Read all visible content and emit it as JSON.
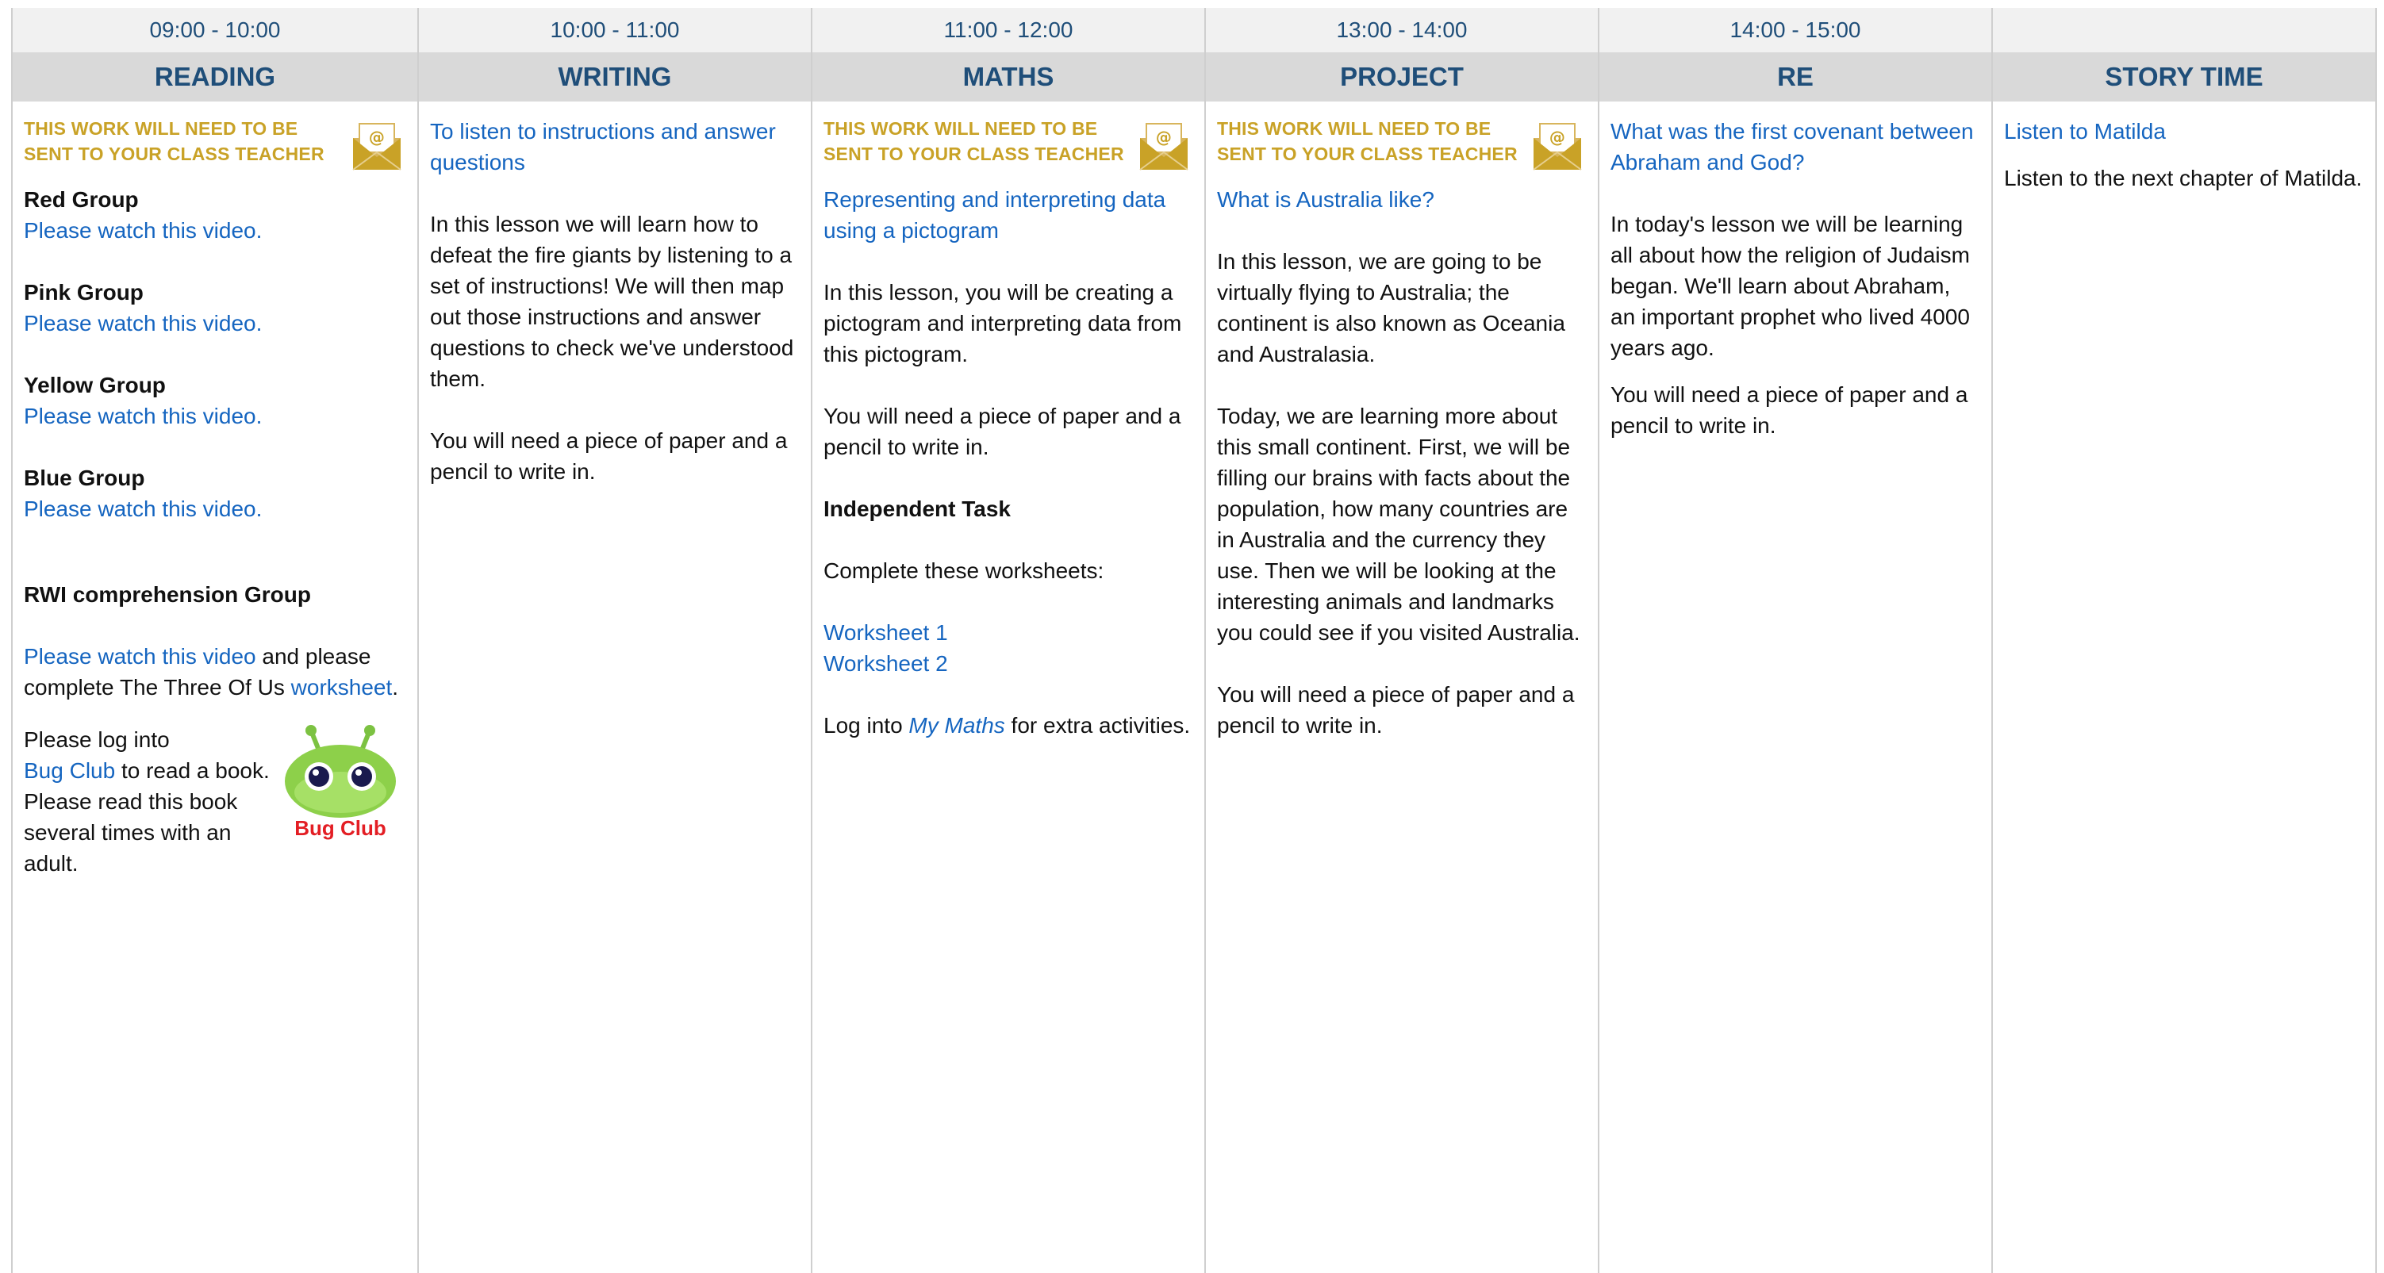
{
  "columns": [
    {
      "time": "09:00 - 10:00",
      "subject": "READING",
      "teacher_note": "THIS WORK WILL NEED TO BE SENT TO YOUR CLASS TEACHER",
      "groups": [
        {
          "name": "Red Group",
          "link": "Please watch this video."
        },
        {
          "name": "Pink Group",
          "link": "Please watch this video."
        },
        {
          "name": "Yellow Group",
          "link": "Please watch this video."
        },
        {
          "name": "Blue Group",
          "link": "Please watch this video."
        }
      ],
      "rwi": {
        "heading": "RWI comprehension Group",
        "link": "Please watch this video",
        "text_mid": " and please complete The Three Of Us ",
        "worksheet_link": "worksheet",
        "text_end": "."
      },
      "bugclub": {
        "text_start": "Please log into ",
        "link": "Bug Club",
        "text_end": " to read a book. Please read this book several times with an adult.",
        "logo_text": "Bug Club"
      }
    },
    {
      "time": "10:00 - 11:00",
      "subject": "WRITING",
      "title_link": "To listen to instructions and answer questions",
      "paragraphs": [
        "In this lesson we will learn how to defeat the fire giants by listening to a set of instructions! We will then map out those instructions and answer questions to check we've understood them.",
        "You will need a piece of paper and a pencil to write in."
      ]
    },
    {
      "time": "11:00 - 12:00",
      "subject": "MATHS",
      "teacher_note": "THIS WORK WILL NEED TO BE SENT TO YOUR CLASS TEACHER",
      "title_link": "Representing and interpreting data using a pictogram",
      "paragraphs": [
        "In this lesson, you will be creating a pictogram and interpreting data from this pictogram.",
        "You will need a piece of paper and a pencil to write in."
      ],
      "task_heading": "Independent Task",
      "task_text": "Complete these worksheets:",
      "worksheets": [
        "Worksheet 1",
        "Worksheet 2"
      ],
      "mymaths": {
        "text_start": "Log into ",
        "link": "My Maths",
        "text_end": " for extra activities."
      }
    },
    {
      "time": "13:00 - 14:00",
      "subject": "PROJECT",
      "teacher_note": "THIS WORK WILL NEED TO BE SENT TO YOUR CLASS TEACHER",
      "title_link": "What is Australia like?",
      "paragraphs": [
        "In this lesson, we are going to be virtually flying to Australia; the continent is also known as Oceania and Australasia.",
        "Today, we are learning more about this small continent. First, we will be filling our brains with facts about the population, how many countries are in Australia and the currency they use. Then we will be looking at the interesting animals and landmarks you could see if you visited Australia.",
        "You will need a piece of paper and a pencil to write in."
      ]
    },
    {
      "time": "14:00 - 15:00",
      "subject": "RE",
      "title_link": "What was the first covenant between Abraham and God?",
      "paragraphs": [
        "In today's lesson we will be learning all about how the religion of Judaism began. We'll learn about Abraham, an important prophet who lived 4000 years ago.",
        "You will need a piece of paper and a pencil to write in."
      ]
    },
    {
      "time": "",
      "subject": "STORY TIME",
      "title_link": "Listen to Matilda",
      "paragraphs": [
        "Listen to the next chapter of Matilda."
      ]
    }
  ]
}
